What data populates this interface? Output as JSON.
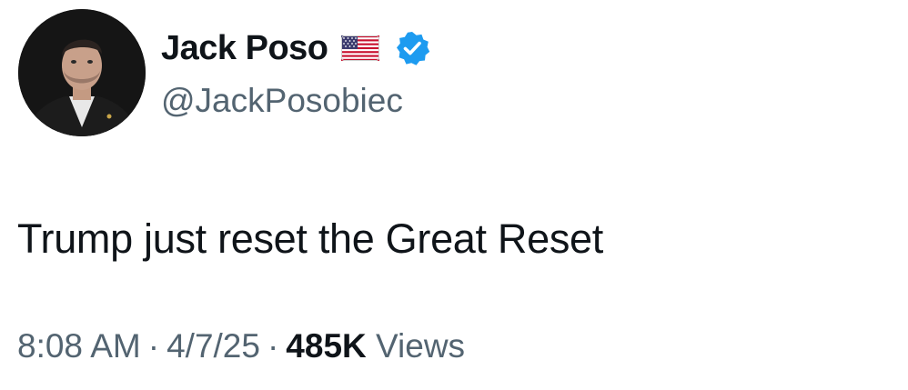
{
  "author": {
    "display_name": "Jack Poso",
    "handle": "@JackPosobiec",
    "flag_icon": "us-flag-icon",
    "verified_icon": "verified-badge-icon",
    "verified_color": "#1d9bf0"
  },
  "tweet": {
    "text": "Trump just reset the Great Reset",
    "time": "8:08 AM",
    "separator": "·",
    "date": "4/7/25",
    "views_count": "485K",
    "views_label": "Views"
  },
  "colors": {
    "primary_text": "#0f1419",
    "secondary_text": "#536471",
    "background": "#ffffff"
  }
}
